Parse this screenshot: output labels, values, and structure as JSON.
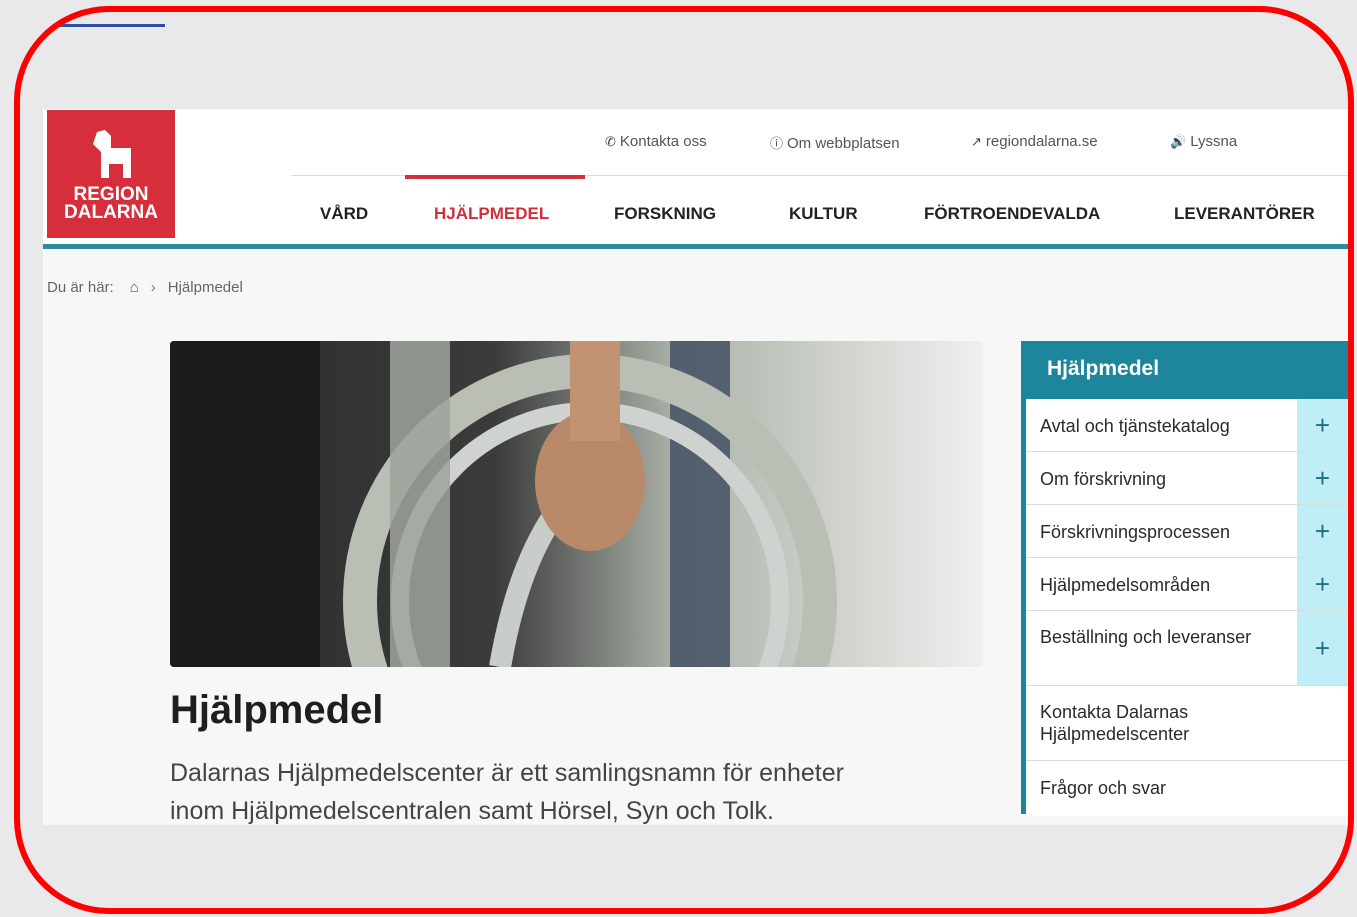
{
  "topnav": {
    "contact": "Kontakta oss",
    "about": "Om webbplatsen",
    "external": "regiondalarna.se",
    "listen": "Lyssna"
  },
  "logo": {
    "line1": "REGION",
    "line2": "DALARNA"
  },
  "mainnav": [
    "VÅRD",
    "HJÄLPMEDEL",
    "FORSKNING",
    "KULTUR",
    "FÖRTROENDEVALDA",
    "LEVERANTÖRER"
  ],
  "active_nav": "HJÄLPMEDEL",
  "breadcrumb": {
    "prefix": "Du är här:",
    "current": "Hjälpmedel",
    "separator": "›"
  },
  "page": {
    "title": "Hjälpmedel",
    "lead_line1": "Dalarnas Hjälpmedelscenter är ett samlingsnamn för enheter",
    "lead_line2": "inom Hjälpmedelscentralen samt Hörsel, Syn och Tolk."
  },
  "sidebar": {
    "title": "Hjälpmedel",
    "items": [
      {
        "label": "Avtal och tjänstekatalog",
        "expandable": true
      },
      {
        "label": "Om förskrivning",
        "expandable": true
      },
      {
        "label": "Förskrivningsprocessen",
        "expandable": true
      },
      {
        "label": "Hjälpmedelsområden",
        "expandable": true
      },
      {
        "label": "Beställning och leveranser",
        "expandable": true
      },
      {
        "label": "Kontakta Dalarnas Hjälpmedelscenter",
        "expandable": false
      },
      {
        "label": "Frågor och svar",
        "expandable": false
      }
    ]
  },
  "icons": {
    "contact": "phone-icon",
    "about": "info-icon",
    "external": "external-link-icon",
    "listen": "speaker-icon",
    "home": "home-icon",
    "expand": "plus-icon"
  },
  "colors": {
    "brand_red": "#d62f3b",
    "teal": "#1d869c",
    "frame_red": "#ff0000",
    "plus_bg": "#bfeef7"
  }
}
